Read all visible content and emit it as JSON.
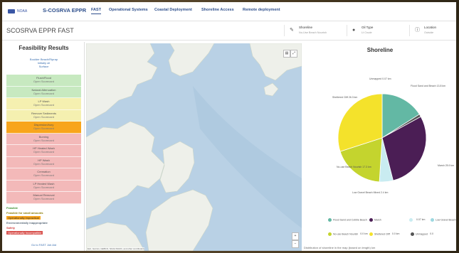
{
  "nav": {
    "logo_text": "NOAA",
    "brand": "S-COSRVA EPPR",
    "tabs": [
      {
        "label": "FAST",
        "active": true
      },
      {
        "label": "Operational Systems",
        "active": false
      },
      {
        "label": "Coastal Deployment",
        "active": false
      },
      {
        "label": "Shoreline Access",
        "active": false
      },
      {
        "label": "Remote deployment",
        "active": false
      }
    ]
  },
  "header": {
    "title": "SCOSRVA EPPR FAST",
    "filters": [
      {
        "label": "Shoreline",
        "value": "No-Use Beach Nourish",
        "icon": "pencil-icon"
      },
      {
        "label": "Oil Type",
        "value": "Lt Crude",
        "icon": "drop-icon"
      },
      {
        "label": "Location",
        "value": "Outside",
        "icon": "info-icon"
      }
    ]
  },
  "left": {
    "title": "Feasibility Results",
    "subtitle_lines": [
      "Boulder Beach/Riprap",
      "Initially oil",
      "Surface"
    ],
    "cards": [
      {
        "title": "Flush/Flood",
        "status": "Open Scorecard",
        "color": "#c7e9c0"
      },
      {
        "title": "Natural Attenuation",
        "status": "Open Scorecard",
        "color": "#c7e9c0"
      },
      {
        "title": "LP Wash",
        "status": "Open Scorecard",
        "color": "#f5f0b0"
      },
      {
        "title": "Remove Sediments",
        "status": "Open Scorecard",
        "color": "#f5f0b0"
      },
      {
        "title": "Dispersion/bury",
        "status": "Open Scorecard",
        "color": "#f8a51c"
      },
      {
        "title": "Burning",
        "status": "Open Scorecard",
        "color": "#f3b9b9"
      },
      {
        "title": "HP Heated Wash",
        "status": "Open Scorecard",
        "color": "#f3b9b9"
      },
      {
        "title": "HP Wash",
        "status": "Open Scorecard",
        "color": "#f3b9b9"
      },
      {
        "title": "Cremation",
        "status": "Open Scorecard",
        "color": "#f3b9b9"
      },
      {
        "title": "LP Heated Wash",
        "status": "Open Scorecard",
        "color": "#f3b9b9"
      },
      {
        "title": "Manual Removal",
        "status": "Open Scorecard",
        "color": "#f3b9b9"
      }
    ],
    "legend": [
      {
        "label": "Feasible",
        "color": "#3e8e2e",
        "bg": "",
        "bold": true
      },
      {
        "label": "Feasible for small amounts",
        "color": "#8a7a00",
        "bg": "",
        "bold": true
      },
      {
        "label": "Operationally impractical",
        "color": "#333333",
        "bg": "#f8a51c",
        "bold": false
      },
      {
        "label": "Environmentally inappropriate",
        "color": "#5a6b7b",
        "bg": "",
        "bold": true
      },
      {
        "label": "Safety",
        "color": "#d13a3a",
        "bg": "",
        "bold": true
      },
      {
        "label": "Operationally Incompatible",
        "color": "#ffffff",
        "bg": "#d9534f",
        "bold": false
      }
    ],
    "footer_link": "Go to FAST Job Aid"
  },
  "map": {
    "plus": "+",
    "minus": "−",
    "attribution": "Esri, Garmin, GEBCO, NOAA NGDC, and other contributors"
  },
  "chart": {
    "title": "Shoreline",
    "footer": "Distribution of shoreline in the map (based on length) km",
    "legend": [
      {
        "label": "Flood Sand and Cobble Beach",
        "value": "",
        "color": "#63b8a4"
      },
      {
        "label": "Marsh",
        "value": "",
        "color": "#4b1e55"
      },
      {
        "label": "",
        "value": "0.07 km",
        "color": "#c9ecf1"
      },
      {
        "label": "Low Gravel Beach Mixed",
        "value": "0.0 km",
        "color": "#9dd8e0"
      },
      {
        "label": "No-use Beach Nourish",
        "value": "0.0 km",
        "color": "#c4d42e"
      },
      {
        "label": "Sheltered Cliff",
        "value": "0.0 km",
        "color": "#f4e22b"
      },
      {
        "label": "Unmapped",
        "value": "0.0",
        "color": "#555555"
      }
    ]
  },
  "chart_data": {
    "type": "pie",
    "title": "Shoreline",
    "slices": [
      {
        "label": "Flood Sand and Cobble Beach",
        "value": 16,
        "color": "#63b8a4"
      },
      {
        "label": "Marsh",
        "value": 29,
        "color": "#4b1e55"
      },
      {
        "label": "Low Gravel Beach Mixed",
        "value": 5,
        "color": "#c9ecf1"
      },
      {
        "label": "No-use Beach Nourish",
        "value": 19,
        "color": "#c4d42e"
      },
      {
        "label": "Sheltered Cliff",
        "value": 30,
        "color": "#f4e22b"
      },
      {
        "label": "Unmapped",
        "value": 1,
        "color": "#555555"
      }
    ],
    "slice_labels": [
      {
        "text": "Unmapped 0.07 km"
      },
      {
        "text": "Flood Sand and Beach 13.8 km"
      },
      {
        "text": "Marsh 25.9 km"
      },
      {
        "text": "Low Gravel Beach Mixed 2.4 km"
      },
      {
        "text": "No-use Beach Nourish 17.3 km"
      },
      {
        "text": "Sheltered Cliff 26.3 km"
      }
    ]
  }
}
